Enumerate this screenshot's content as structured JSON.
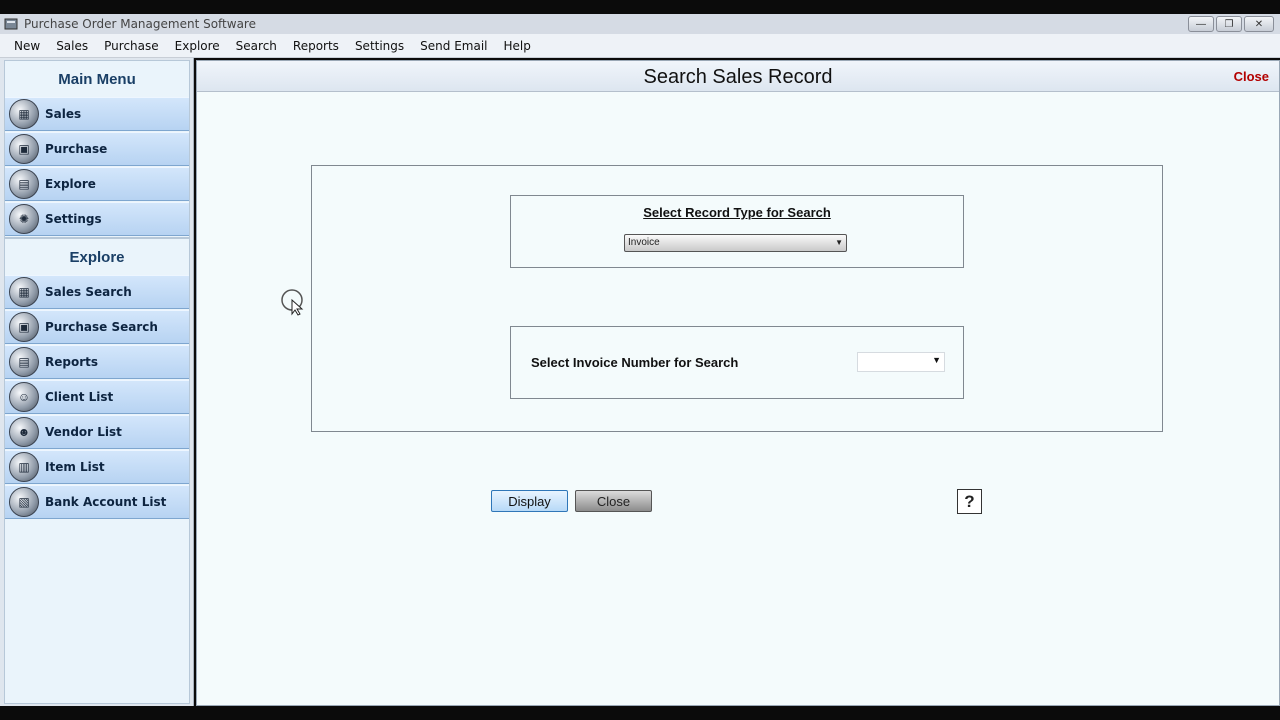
{
  "window": {
    "title": "Purchase Order Management Software",
    "controls": {
      "minimize": "—",
      "maximize": "❐",
      "close": "✕"
    }
  },
  "menubar": {
    "items": [
      {
        "label": "New"
      },
      {
        "label": "Sales"
      },
      {
        "label": "Purchase"
      },
      {
        "label": "Explore"
      },
      {
        "label": "Search"
      },
      {
        "label": "Reports"
      },
      {
        "label": "Settings"
      },
      {
        "label": "Send Email"
      },
      {
        "label": "Help"
      }
    ]
  },
  "sidebar": {
    "main_menu": {
      "title": "Main Menu",
      "items": [
        {
          "label": "Sales",
          "icon": "sales-chart-icon",
          "glyph": "▦"
        },
        {
          "label": "Purchase",
          "icon": "purchase-cart-icon",
          "glyph": "▣"
        },
        {
          "label": "Explore",
          "icon": "explore-folder-icon",
          "glyph": "▤"
        },
        {
          "label": "Settings",
          "icon": "settings-gear-icon",
          "glyph": "✺"
        }
      ]
    },
    "explore": {
      "title": "Explore",
      "items": [
        {
          "label": "Sales Search",
          "icon": "sales-search-icon",
          "glyph": "▦"
        },
        {
          "label": "Purchase Search",
          "icon": "purchase-search-icon",
          "glyph": "▣"
        },
        {
          "label": "Reports",
          "icon": "reports-icon",
          "glyph": "▤"
        },
        {
          "label": "Client List",
          "icon": "client-list-icon",
          "glyph": "☺"
        },
        {
          "label": "Vendor List",
          "icon": "vendor-list-icon",
          "glyph": "☻"
        },
        {
          "label": "Item List",
          "icon": "item-list-icon",
          "glyph": "▥"
        },
        {
          "label": "Bank Account List",
          "icon": "bank-account-icon",
          "glyph": "▧"
        }
      ]
    }
  },
  "main": {
    "title": "Search Sales Record",
    "close_label": "Close",
    "record_type": {
      "label": "Select Record Type for Search",
      "value": "Invoice"
    },
    "invoice_number": {
      "label": "Select Invoice Number for Search",
      "value": ""
    },
    "buttons": {
      "display": "Display",
      "close": "Close",
      "help": "?"
    }
  },
  "colors": {
    "close_link": "#b30000",
    "nav_item": "#c4dcf6",
    "panel_title": "#1a3f66"
  }
}
